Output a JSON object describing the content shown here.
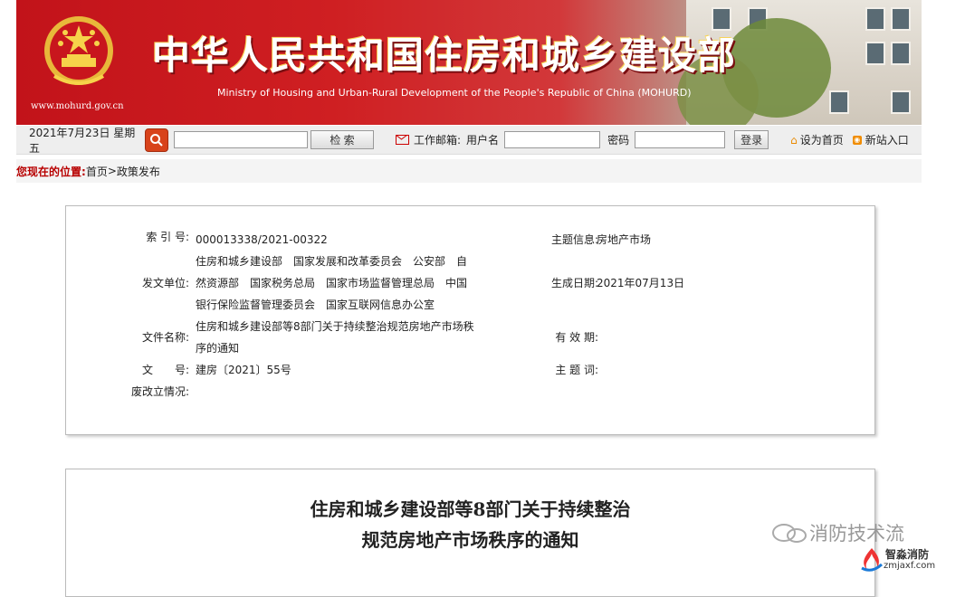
{
  "banner": {
    "title_cn": "中华人民共和国住房和城乡建设部",
    "title_en": "Ministry of Housing and Urban-Rural Development of the People's Republic of China (MOHURD)",
    "url": "www.mohurd.gov.cn"
  },
  "toolbar": {
    "date": "2021年7月23日 星期五",
    "search_button": "检  索",
    "mail_label": "工作邮箱:",
    "username_label": "用户名",
    "password_label": "密码",
    "login_button": "登录",
    "set_homepage": "设为首页",
    "new_site": "新站入口"
  },
  "breadcrumb": {
    "prefix": "您现在的位置:",
    "home": "首页",
    "sep": ">",
    "current": "政策发布"
  },
  "info": {
    "index_label": "索 引 号:",
    "index_value": "000013338/2021-00322",
    "topic_label": "主题信息:",
    "topic_value": "房地产市场",
    "issuer_label": "发文单位:",
    "issuer_value": "住房和城乡建设部　国家发展和改革委员会　公安部　自然资源部　国家税务总局　国家市场监督管理总局　中国银行保险监督管理委员会　国家互联网信息办公室",
    "date_label": "生成日期:",
    "date_value": "2021年07月13日",
    "filename_label": "文件名称:",
    "filename_value": "住房和城乡建设部等8部门关于持续整治规范房地产市场秩序的通知",
    "validity_label": "有 效 期:",
    "docno_label": "文　　号:",
    "docno_value": "建房〔2021〕55号",
    "subject_label": "主 题 词:",
    "abolish_label": "废改立情况:"
  },
  "document": {
    "title_line1": "住房和城乡建设部等8部门关于持续整治",
    "title_line2": "规范房地产市场秩序的通知"
  },
  "watermark": {
    "text": "消防技术流",
    "logo_text": "智淼消防",
    "logo_url": "zmjaxf.com"
  },
  "colors": {
    "banner_red": "#cf1f22",
    "breadcrumb_red": "#b80000",
    "search_orange": "#d8431b"
  }
}
